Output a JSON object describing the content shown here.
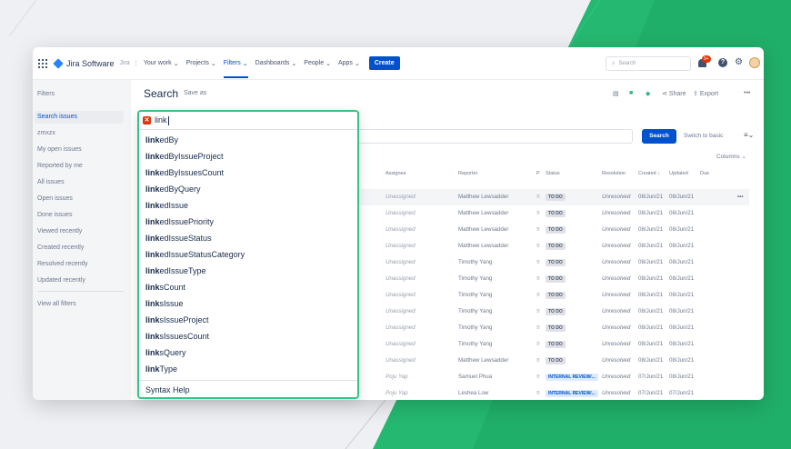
{
  "nav": {
    "product": "Jira Software",
    "product_sub": "Jira",
    "items": [
      "Your work",
      "Projects",
      "Filters",
      "Dashboards",
      "People",
      "Apps"
    ],
    "create": "Create",
    "search_placeholder": "Search",
    "notif_count": "9+"
  },
  "sidebar": {
    "title": "Filters",
    "items": [
      "Search issues",
      "zmxzx",
      "My open issues",
      "Reported by me",
      "All issues",
      "Open issues",
      "Done issues",
      "Viewed recently",
      "Created recently",
      "Resolved recently",
      "Updated recently"
    ],
    "view_all": "View all filters"
  },
  "main": {
    "title": "Search",
    "save_as": "Save as",
    "share": "Share",
    "export": "Export",
    "more": "•••",
    "search_button": "Search",
    "switch_basic": "Switch to basic",
    "columns": "Columns",
    "help": "?"
  },
  "table": {
    "headers": {
      "assignee": "Assignee",
      "reporter": "Reporter",
      "p": "P",
      "status": "Status",
      "resolution": "Resolution",
      "created": "Created ↓",
      "updated": "Updated",
      "due": "Due"
    },
    "rows": [
      {
        "assignee": "Unassigned",
        "reporter": "Matthew Lewsadder",
        "status": "TO DO",
        "resolution": "Unresolved",
        "created": "08/Jun/21",
        "updated": "08/Jun/21"
      },
      {
        "assignee": "Unassigned",
        "reporter": "Matthew Lewsadder",
        "status": "TO DO",
        "resolution": "Unresolved",
        "created": "08/Jun/21",
        "updated": "08/Jun/21"
      },
      {
        "assignee": "Unassigned",
        "reporter": "Matthew Lewsadder",
        "status": "TO DO",
        "resolution": "Unresolved",
        "created": "08/Jun/21",
        "updated": "08/Jun/21"
      },
      {
        "assignee": "Unassigned",
        "reporter": "Matthew Lewsadder",
        "status": "TO DO",
        "resolution": "Unresolved",
        "created": "08/Jun/21",
        "updated": "08/Jun/21"
      },
      {
        "assignee": "Unassigned",
        "reporter": "Timothy Yang",
        "status": "TO DO",
        "resolution": "Unresolved",
        "created": "08/Jun/21",
        "updated": "08/Jun/21"
      },
      {
        "assignee": "Unassigned",
        "reporter": "Timothy Yang",
        "status": "TO DO",
        "resolution": "Unresolved",
        "created": "08/Jun/21",
        "updated": "08/Jun/21"
      },
      {
        "assignee": "Unassigned",
        "reporter": "Timothy Yang",
        "status": "TO DO",
        "resolution": "Unresolved",
        "created": "08/Jun/21",
        "updated": "08/Jun/21"
      },
      {
        "assignee": "Unassigned",
        "reporter": "Timothy Yang",
        "status": "TO DO",
        "resolution": "Unresolved",
        "created": "08/Jun/21",
        "updated": "08/Jun/21"
      },
      {
        "assignee": "Unassigned",
        "reporter": "Timothy Yang",
        "status": "TO DO",
        "resolution": "Unresolved",
        "created": "08/Jun/21",
        "updated": "08/Jun/21"
      },
      {
        "assignee": "Unassigned",
        "reporter": "Timothy Yang",
        "status": "TO DO",
        "resolution": "Unresolved",
        "created": "08/Jun/21",
        "updated": "08/Jun/21"
      },
      {
        "assignee": "Unassigned",
        "reporter": "Matthew Lewsadder",
        "status": "TO DO",
        "resolution": "Unresolved",
        "created": "08/Jun/21",
        "updated": "08/Jun/21"
      },
      {
        "assignee": "Poju Yap",
        "reporter": "Samuel Phua",
        "status": "INTERNAL REVIEW/...",
        "resolution": "Unresolved",
        "created": "07/Jun/21",
        "updated": "08/Jun/21"
      },
      {
        "assignee": "Poju Yap",
        "reporter": "Leshea Low",
        "status": "INTERNAL REVIEW/...",
        "resolution": "Unresolved",
        "created": "07/Jun/21",
        "updated": "07/Jun/21"
      }
    ]
  },
  "autocomplete": {
    "query": "link",
    "items": [
      {
        "match": "link",
        "rest": "edBy"
      },
      {
        "match": "link",
        "rest": "edByIssueProject"
      },
      {
        "match": "link",
        "rest": "edByIssuesCount"
      },
      {
        "match": "link",
        "rest": "edByQuery"
      },
      {
        "match": "link",
        "rest": "edIssue"
      },
      {
        "match": "link",
        "rest": "edIssuePriority"
      },
      {
        "match": "link",
        "rest": "edIssueStatus"
      },
      {
        "match": "link",
        "rest": "edIssueStatusCategory"
      },
      {
        "match": "link",
        "rest": "edIssueType"
      },
      {
        "match": "link",
        "rest": "sCount"
      },
      {
        "match": "link",
        "rest": "sIssue"
      },
      {
        "match": "link",
        "rest": "sIssueProject"
      },
      {
        "match": "link",
        "rest": "sIssuesCount"
      },
      {
        "match": "link",
        "rest": "sQuery"
      },
      {
        "match": "link",
        "rest": "Type"
      }
    ],
    "help": "Syntax Help"
  },
  "colors": {
    "accent": "#0052cc",
    "brand_green": "#2fc687",
    "error": "#de350b"
  }
}
